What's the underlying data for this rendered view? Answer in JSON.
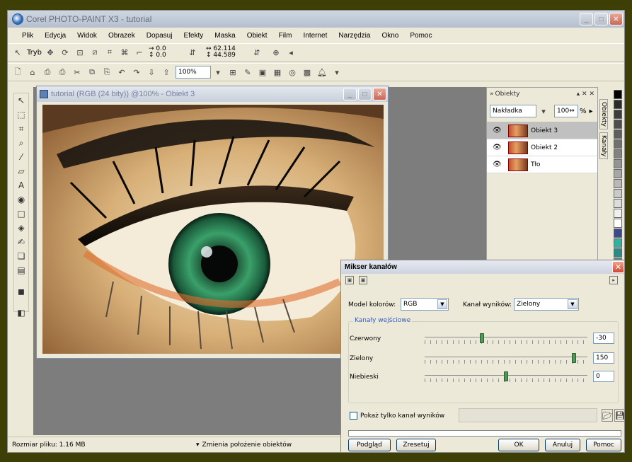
{
  "app": {
    "title": "Corel PHOTO-PAINT X3 - tutorial"
  },
  "menu": [
    "Plik",
    "Edycja",
    "Widok",
    "Obrazek",
    "Dopasuj",
    "Efekty",
    "Maska",
    "Obiekt",
    "Film",
    "Internet",
    "Narzędzia",
    "Okno",
    "Pomoc"
  ],
  "toolbar1": {
    "mode_label": "Tryb",
    "pos_x": "0.0",
    "pos_y": "0.0",
    "width": "62.114",
    "height": "44.589"
  },
  "toolbar2": {
    "zoom": "100%"
  },
  "document": {
    "title": "tutorial (RGB (24 bity)) @100% - Obiekt 3"
  },
  "objects_panel": {
    "title": "Obiekty",
    "blend_mode": "Nakładka",
    "opacity": "100",
    "opacity_unit": "%",
    "layers": [
      "Obiekt 3",
      "Obiekt 2",
      "Tło"
    ],
    "tabs": [
      "Obiekty",
      "Kanały"
    ]
  },
  "palette": [
    "#000000",
    "#2b2b2b",
    "#3c3c3c",
    "#4d4d4d",
    "#5e5e5e",
    "#707070",
    "#828282",
    "#949494",
    "#a6a6a6",
    "#b8b8b8",
    "#cacaca",
    "#dcdcdc",
    "#f0f0f0",
    "#ffffff",
    "#3a4a8a",
    "#32b0a0",
    "#2a8a8a",
    "#3a9c8a"
  ],
  "status": {
    "file_size": "Rozmiar pliku: 1.16 MB",
    "hint": "Zmienia położenie obiektów"
  },
  "dialog": {
    "title": "Mikser kanałów",
    "color_model_label": "Model kolorów:",
    "color_model": "RGB",
    "output_label": "Kanał wyników:",
    "output": "Zielony",
    "group_label": "Kanały wejściowe",
    "channels": [
      {
        "label": "Czerwony",
        "value": "-30",
        "pos": 0.35
      },
      {
        "label": "Zielony",
        "value": "150",
        "pos": 0.93
      },
      {
        "label": "Niebieski",
        "value": "0",
        "pos": 0.5
      }
    ],
    "show_only_label": "Pokaż tylko kanał wyników",
    "buttons": {
      "preview": "Podgląd",
      "reset": "Zresetuj",
      "ok": "OK",
      "cancel": "Anuluj",
      "help": "Pomoc"
    }
  }
}
